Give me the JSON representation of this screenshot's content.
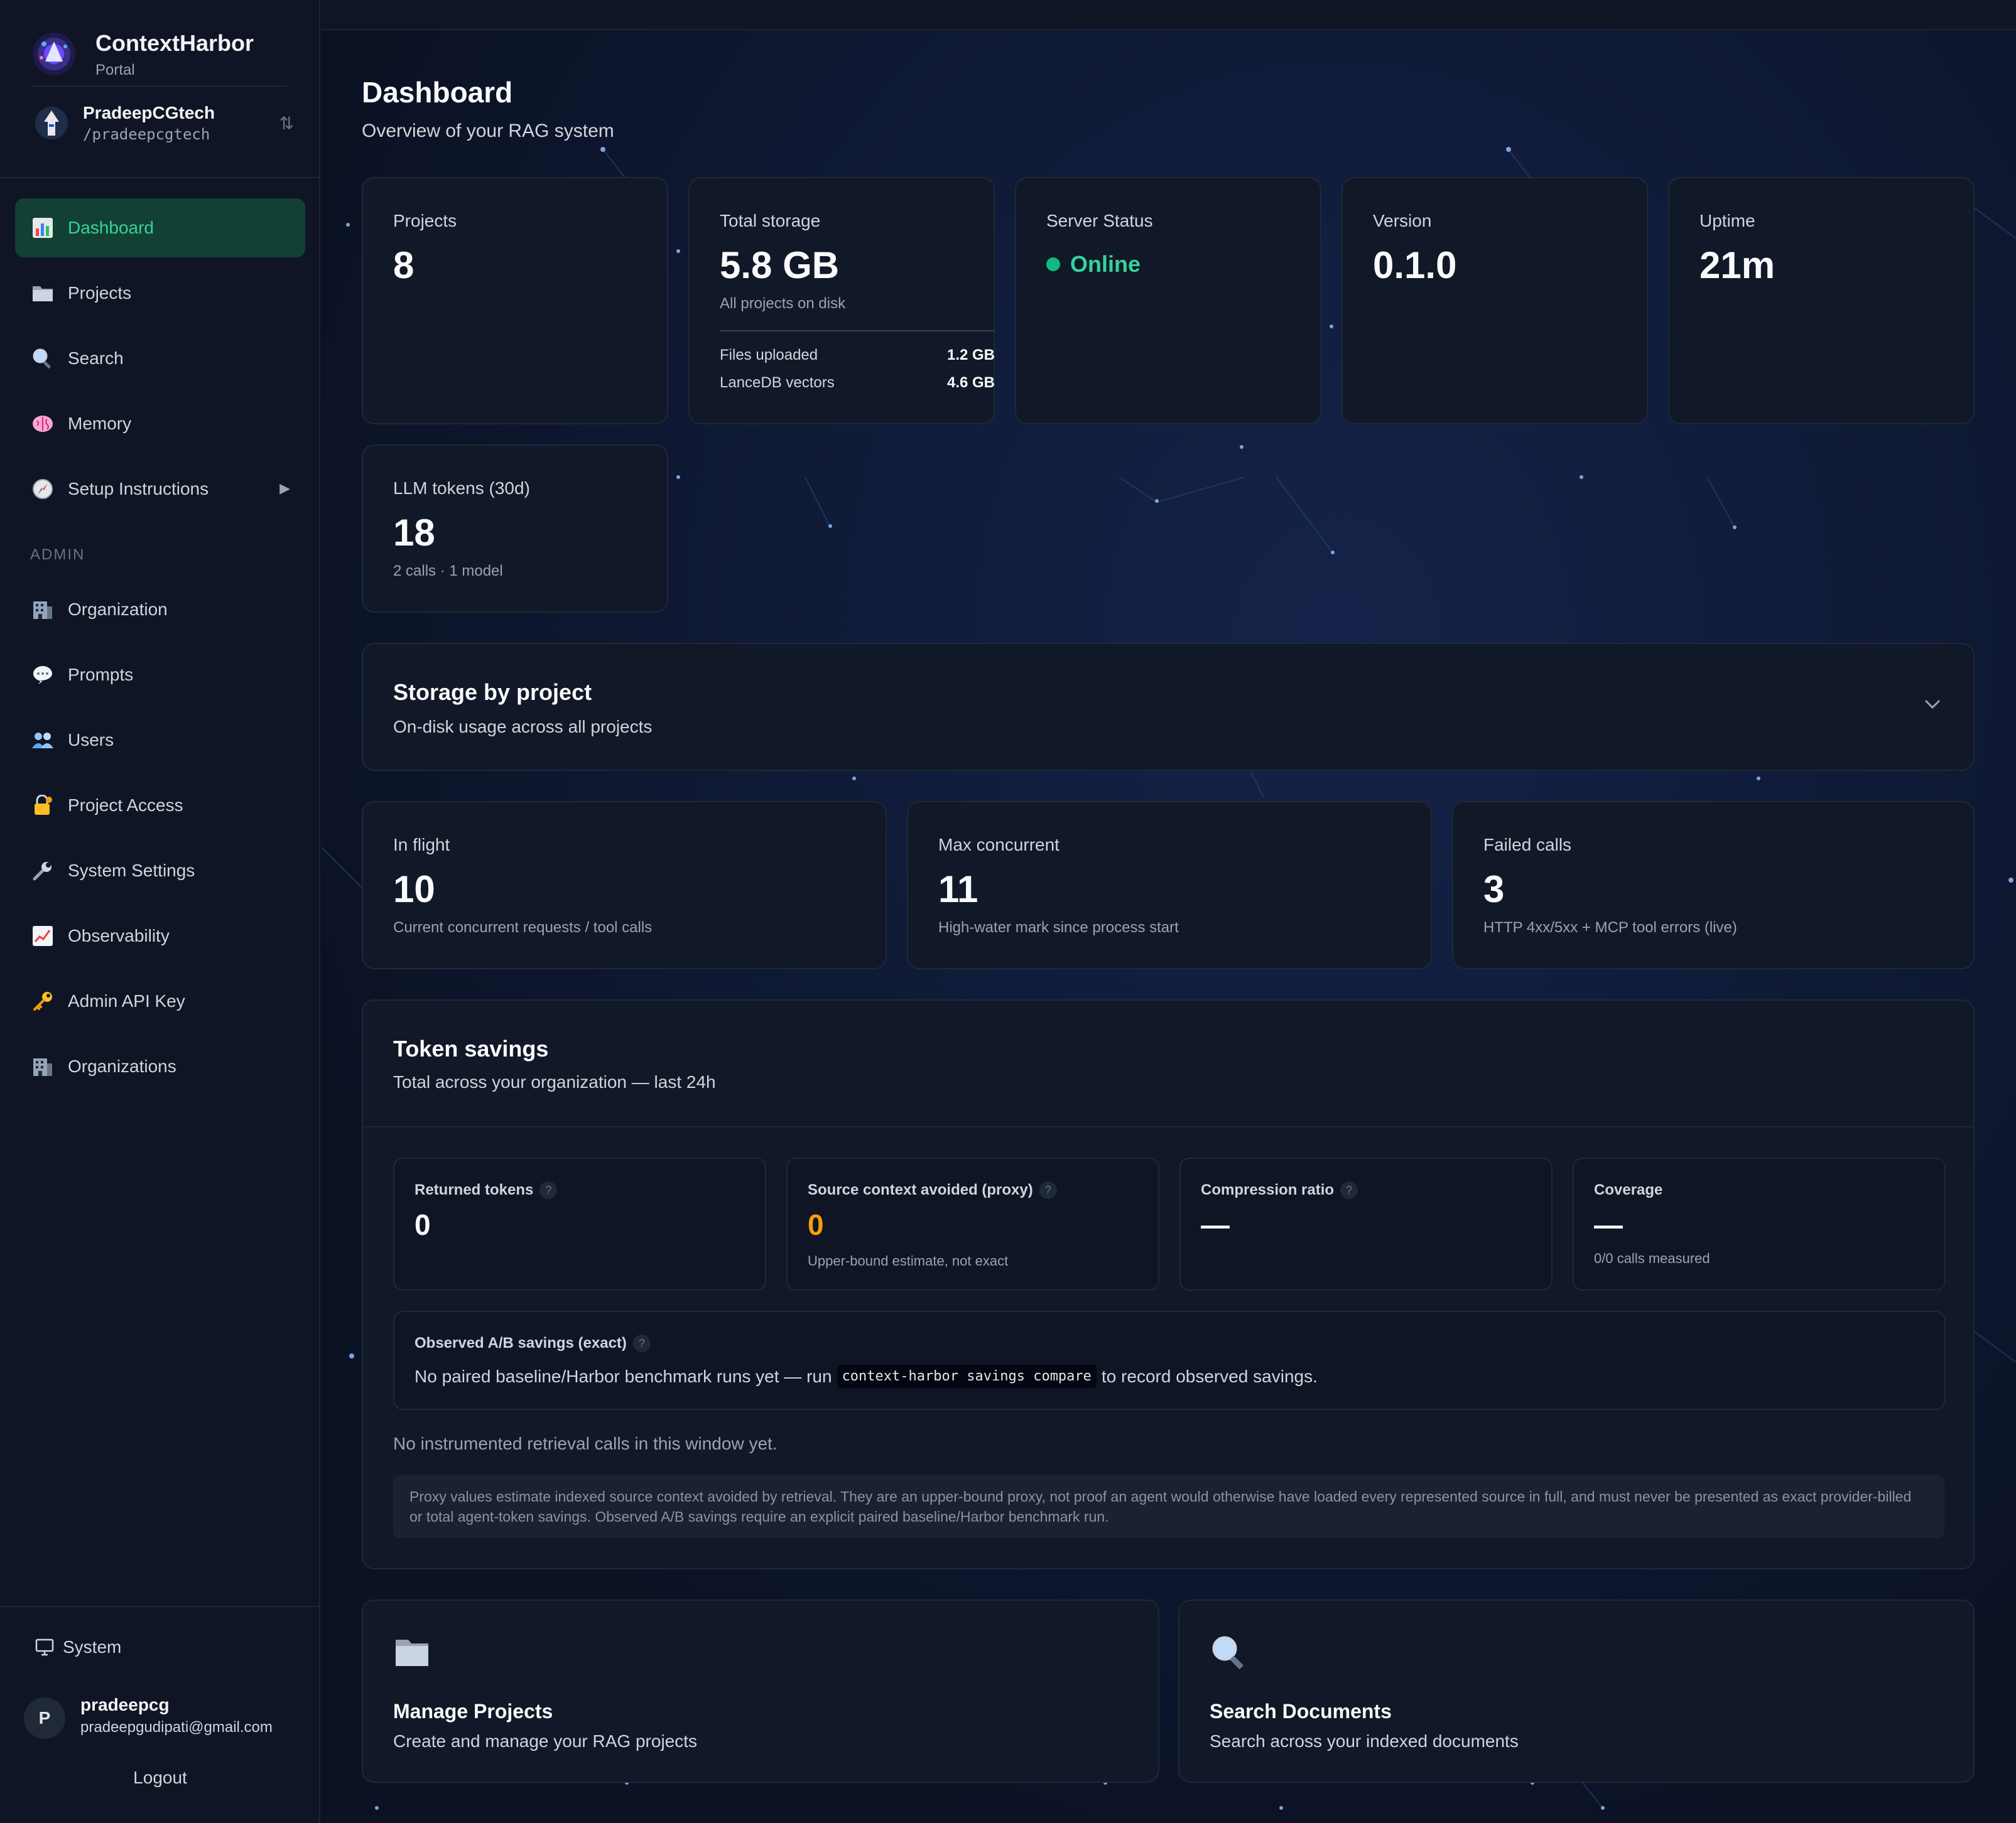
{
  "brand": {
    "name": "ContextHarbor",
    "subtitle": "Portal"
  },
  "account": {
    "name": "PradeepCGtech",
    "handle": "/pradeepcgtech",
    "switch_icon": "swap-arrows-icon"
  },
  "nav": {
    "items": [
      {
        "label": "Dashboard",
        "icon": "bar-chart-icon",
        "active": true
      },
      {
        "label": "Projects",
        "icon": "folder-icon"
      },
      {
        "label": "Search",
        "icon": "magnifier-icon"
      },
      {
        "label": "Memory",
        "icon": "brain-icon"
      },
      {
        "label": "Setup Instructions",
        "icon": "compass-icon",
        "caret": "▶"
      }
    ],
    "admin_heading": "ADMIN",
    "admin_items": [
      {
        "label": "Organization",
        "icon": "building-icon"
      },
      {
        "label": "Prompts",
        "icon": "speech-bubble-icon"
      },
      {
        "label": "Users",
        "icon": "users-icon"
      },
      {
        "label": "Project Access",
        "icon": "lock-key-icon"
      },
      {
        "label": "System Settings",
        "icon": "wrench-icon"
      },
      {
        "label": "Observability",
        "icon": "line-chart-icon"
      },
      {
        "label": "Admin API Key",
        "icon": "key-icon"
      },
      {
        "label": "Organizations",
        "icon": "building-icon"
      }
    ]
  },
  "footer": {
    "theme_label": "System",
    "user": {
      "initial": "P",
      "name": "pradeepcg",
      "email": "pradeepgudipati@gmail.com"
    },
    "logout_label": "Logout"
  },
  "page": {
    "title": "Dashboard",
    "subtitle": "Overview of your RAG system"
  },
  "stats": {
    "projects": {
      "label": "Projects",
      "value": "8"
    },
    "storage": {
      "label": "Total storage",
      "value": "5.8 GB",
      "note": "All projects on disk",
      "rows": [
        {
          "label": "Files uploaded",
          "value": "1.2 GB"
        },
        {
          "label": "LanceDB vectors",
          "value": "4.6 GB"
        }
      ]
    },
    "server": {
      "label": "Server Status",
      "value": "Online",
      "color": "#10b981"
    },
    "version": {
      "label": "Version",
      "value": "0.1.0"
    },
    "uptime": {
      "label": "Uptime",
      "value": "21m"
    },
    "llm_tokens": {
      "label": "LLM tokens (30d)",
      "value": "18",
      "note": "2 calls · 1 model"
    }
  },
  "storage_by_project": {
    "title": "Storage by project",
    "subtitle": "On-disk usage across all projects"
  },
  "concurrency": [
    {
      "label": "In flight",
      "value": "10",
      "note": "Current concurrent requests / tool calls"
    },
    {
      "label": "Max concurrent",
      "value": "11",
      "note": "High-water mark since process start"
    },
    {
      "label": "Failed calls",
      "value": "3",
      "note": "HTTP 4xx/5xx + MCP tool errors (live)"
    }
  ],
  "token_savings": {
    "title": "Token savings",
    "subtitle": "Total across your organization — last 24h",
    "help_glyph": "?",
    "metrics": [
      {
        "label": "Returned tokens",
        "value": "0",
        "note": ""
      },
      {
        "label": "Source context avoided (proxy)",
        "value": "0",
        "note": "Upper-bound estimate, not exact",
        "color": "#f59e0b"
      },
      {
        "label": "Compression ratio",
        "value": "—",
        "note": ""
      },
      {
        "label": "Coverage",
        "value": "—",
        "note": "0/0 calls measured"
      }
    ],
    "ab": {
      "label": "Observed A/B savings (exact)",
      "text_before": "No paired baseline/Harbor benchmark runs yet — run",
      "command": "context-harbor savings compare",
      "text_after": "to record observed savings."
    },
    "empty_message": "No instrumented retrieval calls in this window yet.",
    "disclaimer": "Proxy values estimate indexed source context avoided by retrieval. They are an upper-bound proxy, not proof an agent would otherwise have loaded every represented source in full, and must never be presented as exact provider-billed or total agent-token savings. Observed A/B savings require an explicit paired baseline/Harbor benchmark run."
  },
  "actions": [
    {
      "title": "Manage Projects",
      "description": "Create and manage your RAG projects",
      "icon": "folder-icon"
    },
    {
      "title": "Search Documents",
      "description": "Search across your indexed documents",
      "icon": "magnifier-icon"
    }
  ],
  "colors": {
    "accent": "#34d399",
    "active_bg": "#134034",
    "amber": "#f59e0b",
    "card_bg": "#111827"
  }
}
